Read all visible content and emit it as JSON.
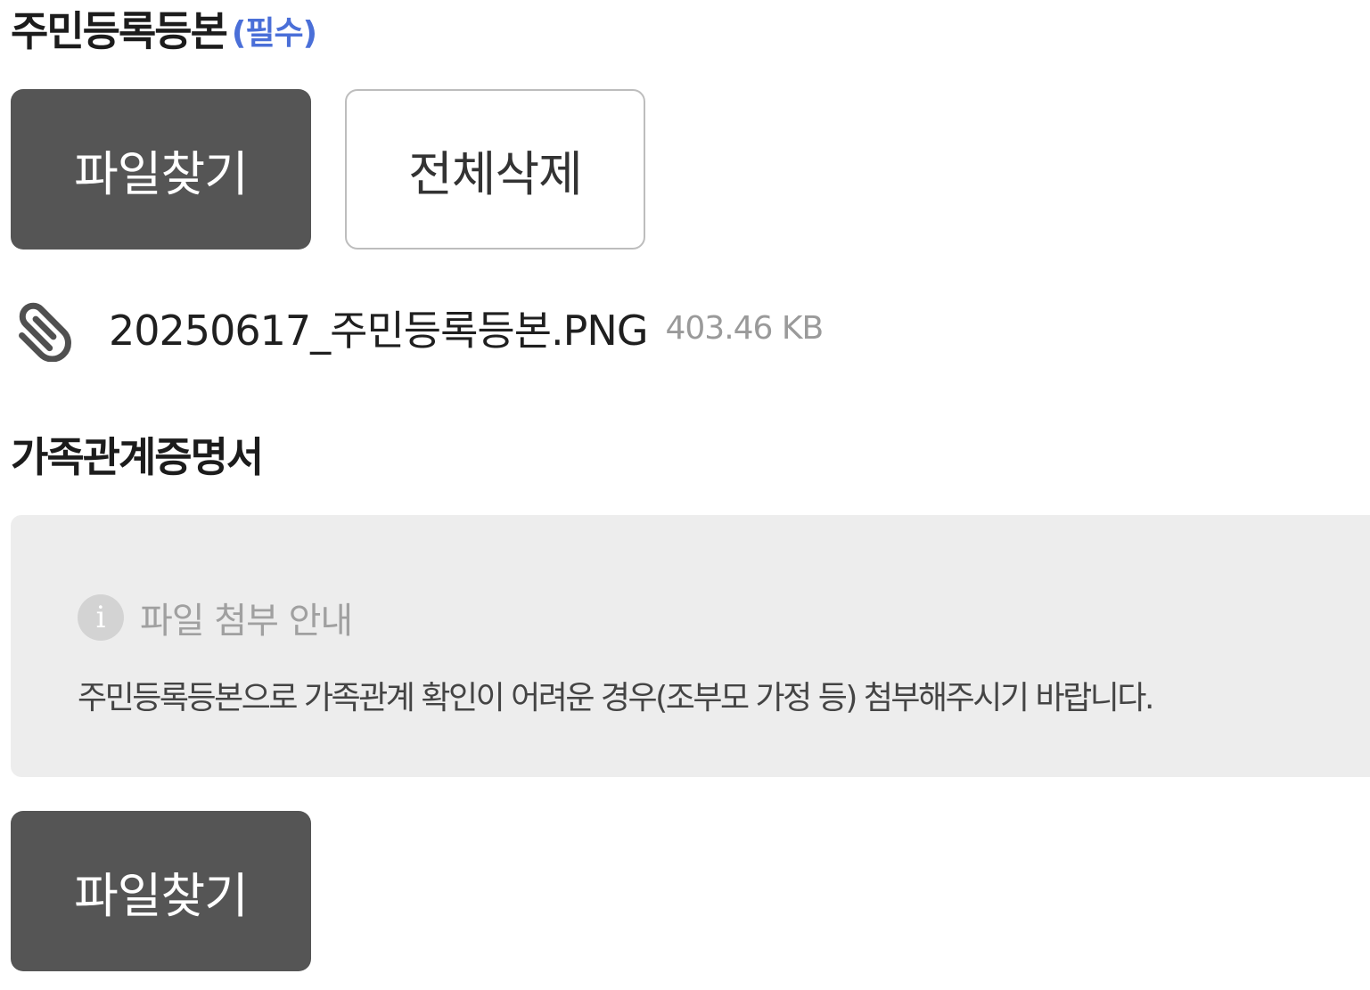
{
  "resident_registration": {
    "title": "주민등록등본",
    "required_label": "(필수)",
    "find_file_label": "파일찾기",
    "delete_all_label": "전체삭제",
    "attached_file": {
      "icon": "paperclip-icon",
      "name": "20250617_주민등록등본.PNG",
      "size": "403.46 KB"
    }
  },
  "family_relation": {
    "title": "가족관계증명서",
    "notice": {
      "icon": "info-icon",
      "icon_glyph": "i",
      "title": "파일 첨부 안내",
      "text": "주민등록등본으로 가족관계 확인이 어려운 경우(조부모 가정 등) 첨부해주시기 바랍니다."
    },
    "find_file_label": "파일찾기"
  },
  "colors": {
    "dark_button": "#555555",
    "required_accent": "#4a6fd8",
    "notice_background": "#ededed"
  }
}
